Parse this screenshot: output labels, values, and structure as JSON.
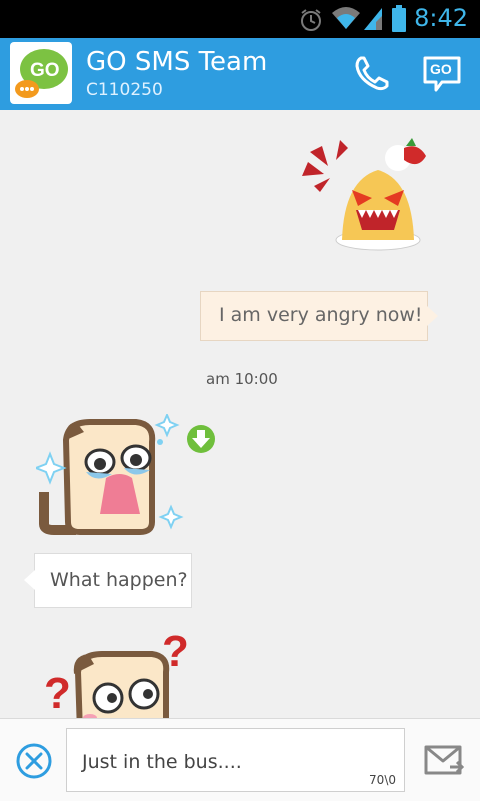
{
  "status_bar": {
    "time": "8:42",
    "icons": [
      "alarm-icon",
      "wifi-icon",
      "signal-icon",
      "battery-icon"
    ]
  },
  "header": {
    "contact_name": "GO SMS Team",
    "contact_number": "C110250",
    "avatar_text": "GO",
    "go_button_label": "GO",
    "accent_color": "#2e9de0"
  },
  "conversation": {
    "outgoing_message": "I am very angry now!",
    "timestamp": "am 10:00",
    "incoming_message": "What happen?"
  },
  "composer": {
    "draft_text": "Just in the bus....",
    "char_counter": "70\\0"
  }
}
